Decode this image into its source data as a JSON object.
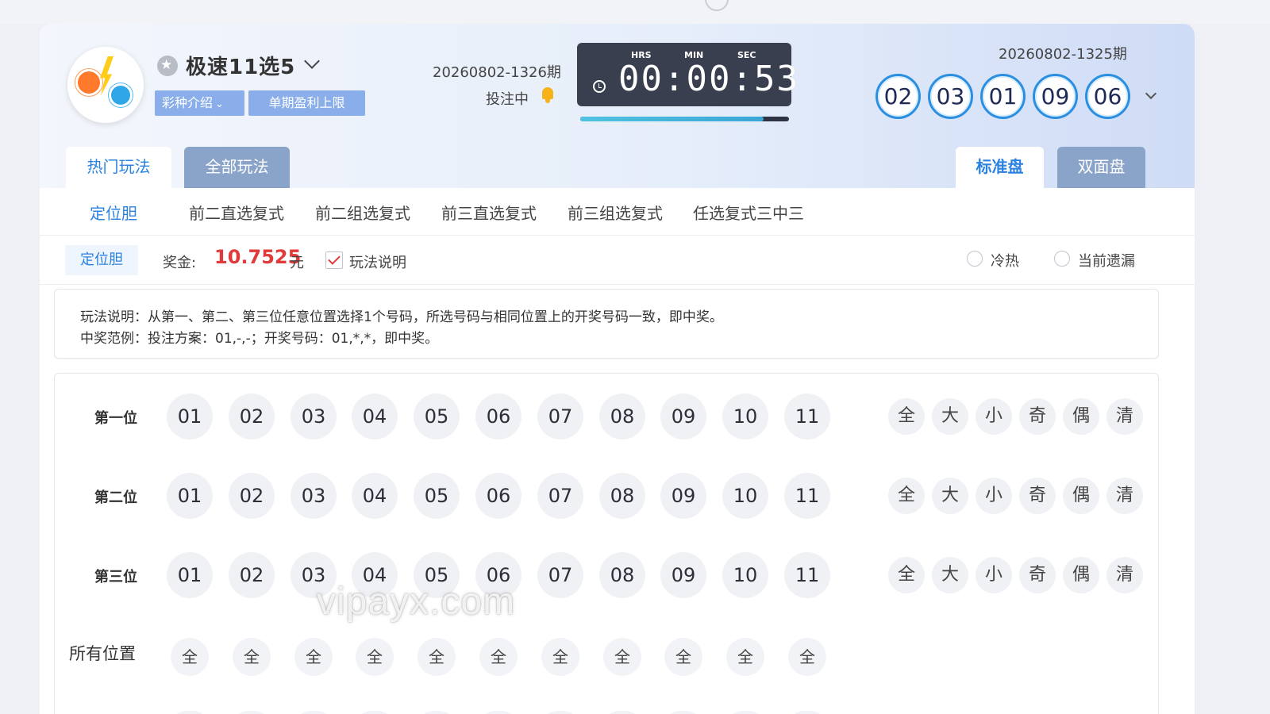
{
  "header": {
    "game_title": "极速11选5",
    "tags": {
      "intro": "彩种介绍",
      "limit": "单期盈利上限"
    },
    "current_period": "20260802-1326期",
    "status": "投注中",
    "timer": {
      "hrs_label": "HRS",
      "min_label": "MIN",
      "sec_label": "SEC",
      "display": "00:00:53",
      "progress": 0.88
    },
    "last_period": "20260802-1325期",
    "last_results": [
      "02",
      "03",
      "01",
      "09",
      "06"
    ]
  },
  "tabs": {
    "hot": "热门玩法",
    "all": "全部玩法",
    "standard": "标准盘",
    "dual": "双面盘"
  },
  "subnav": [
    "定位胆",
    "前二直选复式",
    "前二组选复式",
    "前三直选复式",
    "前三组选复式",
    "任选复式三中三"
  ],
  "bar": {
    "mode": "定位胆",
    "prize_label": "奖金:",
    "prize_value": "10.7525",
    "prize_unit": "元",
    "explain_label": "玩法说明",
    "explain_checked": true,
    "radio_hot": "冷热",
    "radio_miss": "当前遗漏"
  },
  "description": {
    "line1": "玩法说明：从第一、第二、第三位任意位置选择1个号码，所选号码与相同位置上的开奖号码一致，即中奖。",
    "line2": "中奖范例：投注方案：01,-,-；开奖号码：01,*,*，即中奖。"
  },
  "positions": [
    {
      "label": "第一位"
    },
    {
      "label": "第二位"
    },
    {
      "label": "第三位"
    }
  ],
  "numbers": [
    "01",
    "02",
    "03",
    "04",
    "05",
    "06",
    "07",
    "08",
    "09",
    "10",
    "11"
  ],
  "quick_buttons": [
    "全",
    "大",
    "小",
    "奇",
    "偶",
    "清"
  ],
  "all_positions": {
    "label": "所有位置",
    "button": "全"
  },
  "watermark": "vipayx.com",
  "colors": {
    "accent": "#2b82e0",
    "prize": "#e03a3a",
    "result_ring": "#2a8fe0",
    "timer_bg": "#3a3f4f"
  }
}
